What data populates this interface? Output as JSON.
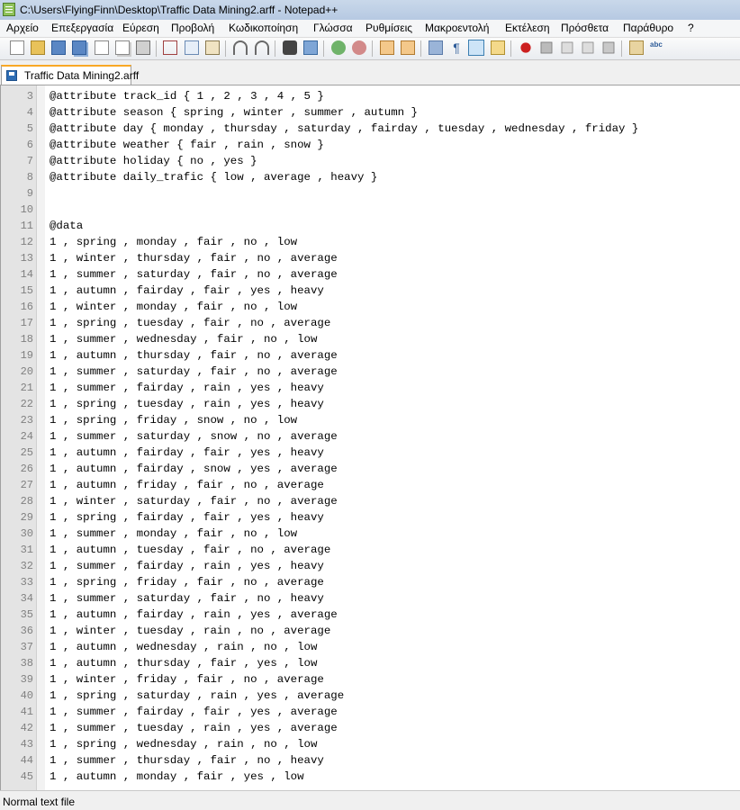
{
  "window": {
    "title": "C:\\Users\\FlyingFinn\\Desktop\\Traffic Data Mining2.arff - Notepad++"
  },
  "menu": [
    "Αρχείο",
    "Επεξεργασία",
    "Εύρεση",
    "Προβολή",
    "Κωδικοποίηση",
    "Γλώσσα",
    "Ρυθμίσεις",
    "Μακροεντολή",
    "Εκτέλεση",
    "Πρόσθετα",
    "Παράθυρο",
    "?"
  ],
  "toolbar": {
    "icons": [
      "new-file-icon",
      "open-file-icon",
      "save-icon",
      "save-all-icon",
      "close-icon",
      "close-all-icon",
      "print-icon",
      "cut-icon",
      "copy-icon",
      "paste-icon",
      "undo-icon",
      "redo-icon",
      "find-icon",
      "replace-icon",
      "zoom-in-icon",
      "zoom-out-icon",
      "sync-vertical-icon",
      "sync-horizontal-icon",
      "word-wrap-icon",
      "show-all-chars-icon",
      "indent-guide-icon",
      "document-map-icon",
      "record-macro-icon",
      "stop-record-icon",
      "play-macro-icon",
      "run-macro-multiple-icon",
      "save-macro-icon",
      "spell-check-icon",
      "abc-check-icon"
    ]
  },
  "tab": {
    "label": "Traffic Data Mining2.arff"
  },
  "editor": {
    "lines": [
      {
        "num": "3",
        "text": "@attribute track_id { 1 , 2 , 3 , 4 , 5 }"
      },
      {
        "num": "4",
        "text": "@attribute season { spring , winter , summer , autumn }"
      },
      {
        "num": "5",
        "text": "@attribute day { monday , thursday , saturday , fairday , tuesday , wednesday , friday }"
      },
      {
        "num": "6",
        "text": "@attribute weather { fair , rain , snow }"
      },
      {
        "num": "7",
        "text": "@attribute holiday { no , yes }"
      },
      {
        "num": "8",
        "text": "@attribute daily_trafic { low , average , heavy }"
      },
      {
        "num": "9",
        "text": ""
      },
      {
        "num": "10",
        "text": ""
      },
      {
        "num": "11",
        "text": "@data"
      },
      {
        "num": "12",
        "text": "1 , spring , monday , fair , no , low"
      },
      {
        "num": "13",
        "text": "1 , winter , thursday , fair , no , average"
      },
      {
        "num": "14",
        "text": "1 , summer , saturday , fair , no , average"
      },
      {
        "num": "15",
        "text": "1 , autumn , fairday , fair , yes , heavy"
      },
      {
        "num": "16",
        "text": "1 , winter , monday , fair , no , low"
      },
      {
        "num": "17",
        "text": "1 , spring , tuesday , fair , no , average"
      },
      {
        "num": "18",
        "text": "1 , summer , wednesday , fair , no , low"
      },
      {
        "num": "19",
        "text": "1 , autumn , thursday , fair , no , average"
      },
      {
        "num": "20",
        "text": "1 , summer , saturday , fair , no , average"
      },
      {
        "num": "21",
        "text": "1 , summer , fairday , rain , yes , heavy"
      },
      {
        "num": "22",
        "text": "1 , spring , tuesday , rain , yes , heavy"
      },
      {
        "num": "23",
        "text": "1 , spring , friday , snow , no , low"
      },
      {
        "num": "24",
        "text": "1 , summer , saturday , snow , no , average"
      },
      {
        "num": "25",
        "text": "1 , autumn , fairday , fair , yes , heavy"
      },
      {
        "num": "26",
        "text": "1 , autumn , fairday , snow , yes , average"
      },
      {
        "num": "27",
        "text": "1 , autumn , friday , fair , no , average"
      },
      {
        "num": "28",
        "text": "1 , winter , saturday , fair , no , average"
      },
      {
        "num": "29",
        "text": "1 , spring , fairday , fair , yes , heavy"
      },
      {
        "num": "30",
        "text": "1 , summer , monday , fair , no , low"
      },
      {
        "num": "31",
        "text": "1 , autumn , tuesday , fair , no , average"
      },
      {
        "num": "32",
        "text": "1 , summer , fairday , rain , yes , heavy"
      },
      {
        "num": "33",
        "text": "1 , spring , friday , fair , no , average"
      },
      {
        "num": "34",
        "text": "1 , summer , saturday , fair , no , heavy"
      },
      {
        "num": "35",
        "text": "1 , autumn , fairday , rain , yes , average"
      },
      {
        "num": "36",
        "text": "1 , winter , tuesday , rain , no , average"
      },
      {
        "num": "37",
        "text": "1 , autumn , wednesday , rain , no , low"
      },
      {
        "num": "38",
        "text": "1 , autumn , thursday , fair , yes , low"
      },
      {
        "num": "39",
        "text": "1 , winter , friday , fair , no , average"
      },
      {
        "num": "40",
        "text": "1 , spring , saturday , rain , yes , average"
      },
      {
        "num": "41",
        "text": "1 , summer , fairday , fair , yes , average"
      },
      {
        "num": "42",
        "text": "1 , summer , tuesday , rain , yes , average"
      },
      {
        "num": "43",
        "text": "1 , spring , wednesday , rain , no , low"
      },
      {
        "num": "44",
        "text": "1 , summer , thursday , fair , no , heavy"
      },
      {
        "num": "45",
        "text": "1 , autumn , monday , fair , yes , low"
      }
    ]
  },
  "status": {
    "text": "Normal text file"
  },
  "colors": {
    "tab_accent": "#f9a825",
    "gutter_bg": "#e4e4e4",
    "line_number": "#808080"
  }
}
